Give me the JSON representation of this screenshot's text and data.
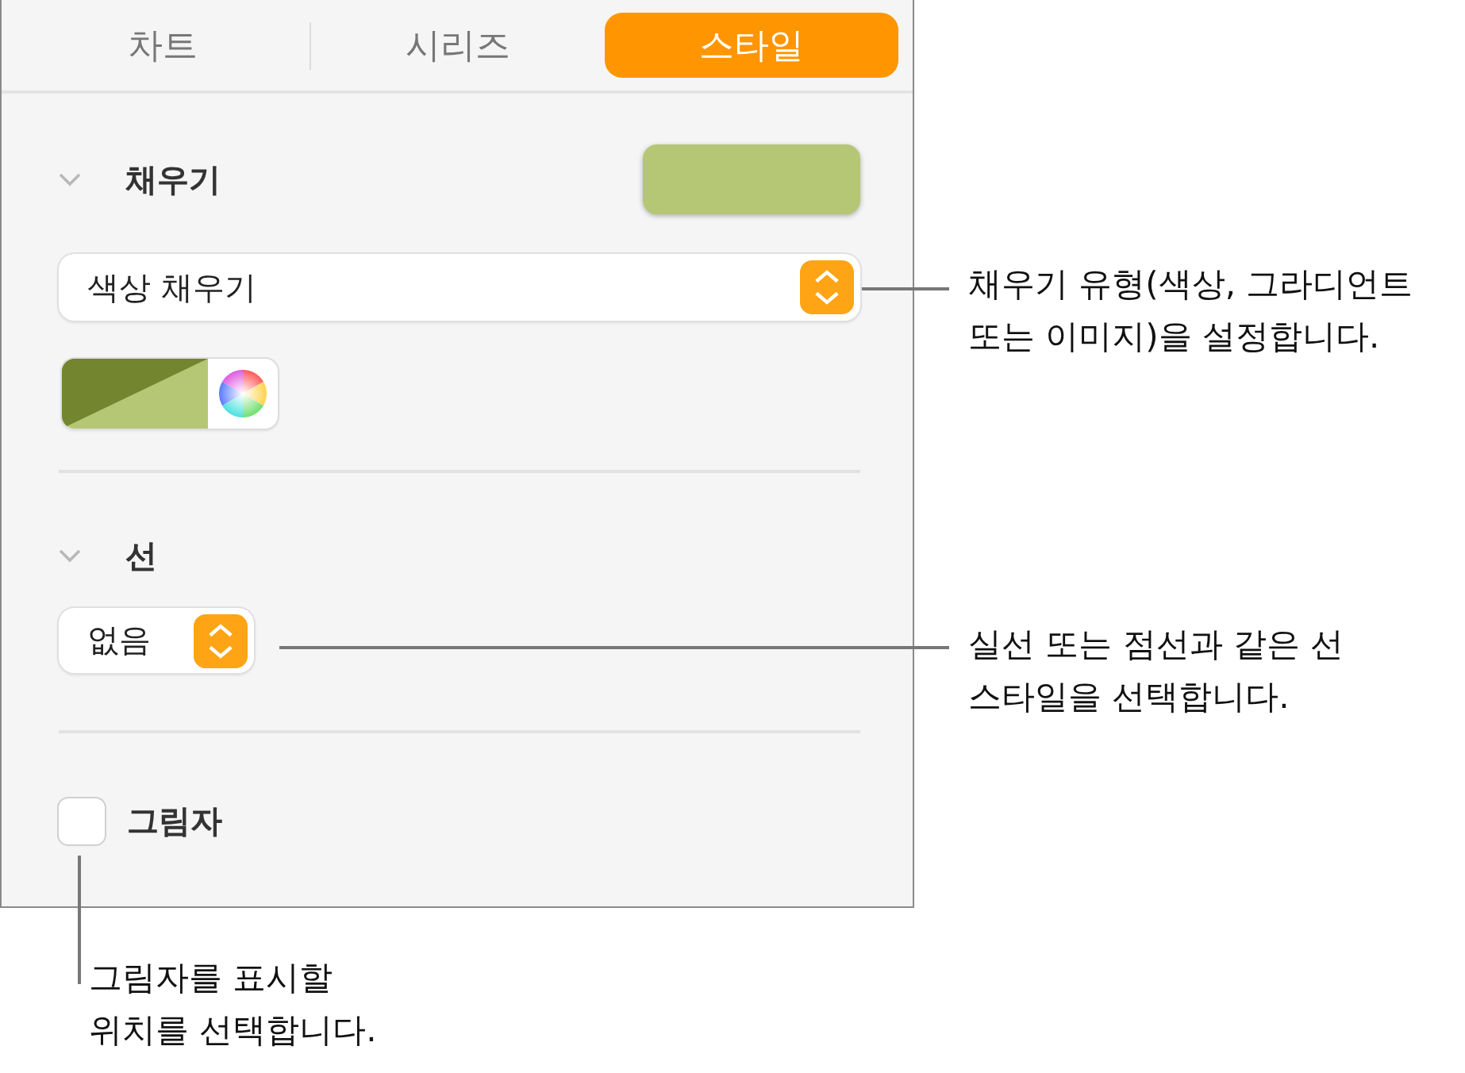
{
  "tabs": [
    {
      "label": "차트",
      "selected": false
    },
    {
      "label": "시리즈",
      "selected": false
    },
    {
      "label": "스타일",
      "selected": true
    }
  ],
  "fill": {
    "title": "채우기",
    "expanded": true,
    "type": {
      "value": "색상 채우기"
    }
  },
  "line": {
    "title": "선",
    "expanded": true,
    "style": {
      "value": "없음"
    }
  },
  "shadow": {
    "label": "그림자",
    "checked": false
  },
  "callouts": [
    {
      "text": "채우기 유형(색상, 그라디언트\n또는 이미지)을 설정합니다."
    },
    {
      "text": "실선 또는 점선과 같은 선\n스타일을 선택합니다."
    },
    {
      "text": "그림자를 표시할\n위치를 선택합니다."
    }
  ]
}
